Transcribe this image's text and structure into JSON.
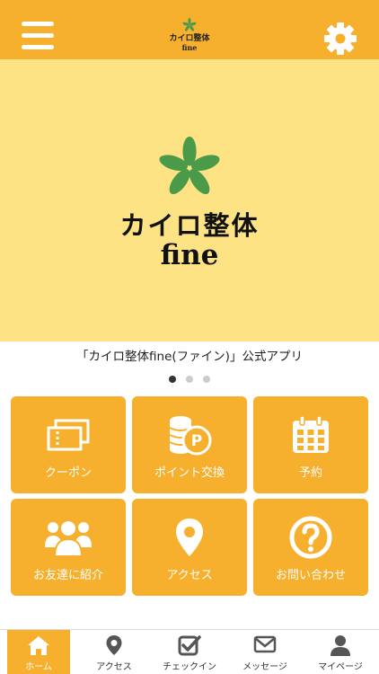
{
  "header": {
    "logo_line1": "カイロ整体",
    "logo_line2": "fine",
    "menu_icon": "hamburger-menu-icon",
    "settings_icon": "gear-icon"
  },
  "hero": {
    "title": "カイロ整体",
    "subtitle": "fine",
    "logo_icon": "leaf-logo-icon",
    "background_color": "#fde383"
  },
  "caption": "「カイロ整体fine(ファイン)」公式アプリ",
  "carousel": {
    "pages": 3,
    "active_index": 0
  },
  "tiles": [
    {
      "label": "クーポン",
      "icon": "ticket-icon"
    },
    {
      "label": "ポイント交換",
      "icon": "coins-icon"
    },
    {
      "label": "予約",
      "icon": "calendar-icon"
    },
    {
      "label": "お友達に紹介",
      "icon": "users-icon"
    },
    {
      "label": "アクセス",
      "icon": "map-pin-icon"
    },
    {
      "label": "お問い合わせ",
      "icon": "question-icon"
    }
  ],
  "tabbar": [
    {
      "label": "ホーム",
      "icon": "home-icon",
      "active": true
    },
    {
      "label": "アクセス",
      "icon": "map-pin-icon",
      "active": false
    },
    {
      "label": "チェックイン",
      "icon": "checkbox-icon",
      "active": false
    },
    {
      "label": "メッセージ",
      "icon": "envelope-icon",
      "active": false
    },
    {
      "label": "マイページ",
      "icon": "person-icon",
      "active": false
    }
  ],
  "colors": {
    "accent": "#f6b02e",
    "hero": "#fde383",
    "leaf": "#4a9a4a"
  }
}
